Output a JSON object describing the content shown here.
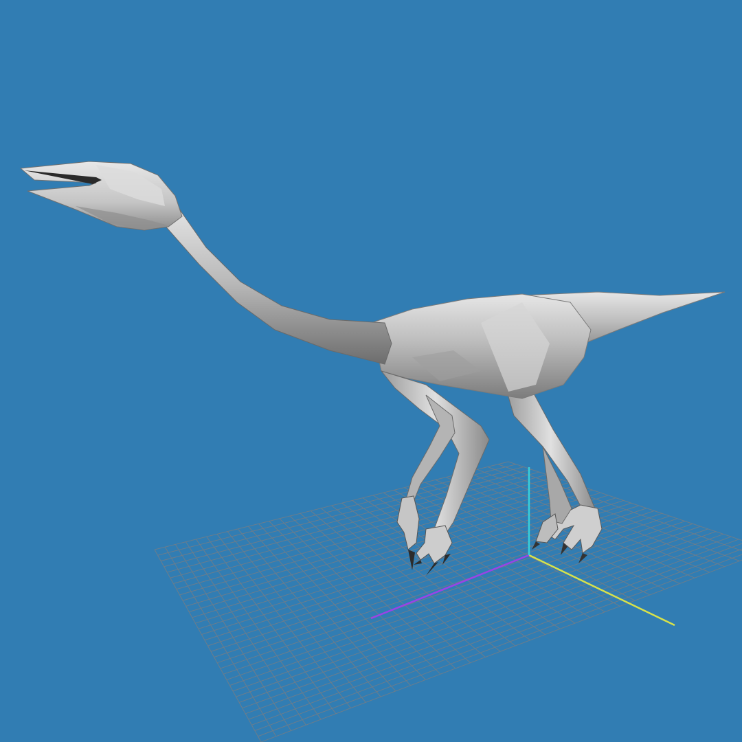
{
  "viewport": {
    "background_color": "#317db3",
    "grid_line_color": "#6b7d8c",
    "axis_colors": {
      "x": "#d8e24a",
      "y": "#36d0dc",
      "z": "#9b43e6"
    },
    "model": {
      "name": "dinosaur-mesh",
      "base_color": "#c8c8c8",
      "shading": "smooth-gray"
    }
  }
}
